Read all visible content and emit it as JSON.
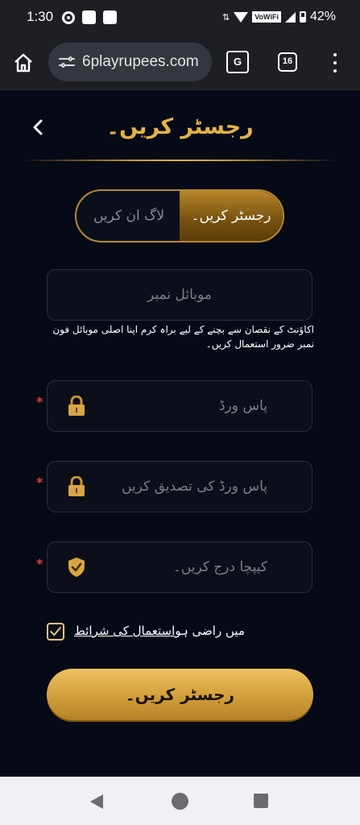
{
  "status_bar": {
    "time": "1:30",
    "vowifi": "VoWiFi",
    "battery": "42%"
  },
  "browser": {
    "url": "6playrupees.com",
    "translate_label": "G",
    "tab_count": "16"
  },
  "page": {
    "title": "رجسٹر کریں۔",
    "toggle": {
      "login_label": "لاگ ان کریں",
      "register_label": "رجسٹر کریں۔"
    },
    "form": {
      "mobile_placeholder": "موبائل نمبر",
      "mobile_hint": "اکاؤنٹ کے نقصان سے بچنے کے لیے براہ کرم اپنا اصلی موبائل فون نمبر ضرور استعمال کریں۔",
      "password_placeholder": "پاس ورڈ",
      "confirm_password_placeholder": "پاس ورڈ کی تصدیق کریں",
      "captcha_placeholder": "کیپچا درج کریں۔",
      "required_mark": "*"
    },
    "terms": {
      "prefix": "میں راضی ہو",
      "link": "استعمال کی شرائط",
      "checked": true
    },
    "submit_label": "رجسٹر کریں۔"
  },
  "colors": {
    "accent": "#e3b24a",
    "background": "#060a17",
    "required": "#e63b3b"
  }
}
